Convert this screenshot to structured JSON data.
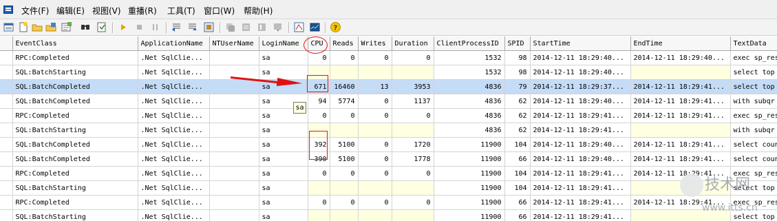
{
  "menu": {
    "items": [
      "文件(F)",
      "编辑(E)",
      "视图(V)",
      "重播(R)",
      "工具(T)",
      "窗口(W)",
      "帮助(H)"
    ]
  },
  "toolbar": {
    "icons": [
      "new-trace-icon",
      "new-template-icon",
      "open-icon",
      "save-icon",
      "properties-icon",
      "find-icon",
      "clear-window-icon",
      "run-icon",
      "stop-icon",
      "pause-icon",
      "step-icon",
      "run-to-cursor-icon",
      "replay-icon",
      "toggle-bookmark-icon",
      "next-bookmark-icon",
      "prev-bookmark-icon",
      "clear-bookmarks-icon",
      "go-to-line-icon",
      "performance-monitor-icon",
      "performance-chart-icon",
      "help-icon"
    ]
  },
  "grid": {
    "columns": [
      "EventClass",
      "ApplicationName",
      "NTUserName",
      "LoginName",
      "CPU",
      "Reads",
      "Writes",
      "Duration",
      "ClientProcessID",
      "SPID",
      "StartTime",
      "EndTime",
      "TextData"
    ],
    "rows": [
      {
        "EventClass": "RPC:Completed",
        "ApplicationName": ".Net SqlClie...",
        "NTUserName": "",
        "LoginName": "sa",
        "CPU": "0",
        "Reads": "0",
        "Writes": "0",
        "Duration": "0",
        "ClientProcessID": "1532",
        "SPID": "98",
        "StartTime": "2014-12-11 18:29:40...",
        "EndTime": "2014-12-11 18:29:40...",
        "TextData": "exec sp_reset"
      },
      {
        "EventClass": "SQL:BatchStarting",
        "ApplicationName": ".Net SqlClie...",
        "NTUserName": "",
        "LoginName": "sa",
        "CPU": "",
        "Reads": "",
        "Writes": "",
        "Duration": "",
        "ClientProcessID": "1532",
        "SPID": "98",
        "StartTime": "2014-12-11 18:29:40...",
        "EndTime": "",
        "TextData": "select top"
      },
      {
        "EventClass": "SQL:BatchCompleted",
        "ApplicationName": ".Net SqlClie...",
        "NTUserName": "",
        "LoginName": "sa",
        "CPU": "671",
        "Reads": "16460",
        "Writes": "13",
        "Duration": "3953",
        "ClientProcessID": "4836",
        "SPID": "79",
        "StartTime": "2014-12-11 18:29:37...",
        "EndTime": "2014-12-11 18:29:41...",
        "TextData": "select top"
      },
      {
        "EventClass": "SQL:BatchCompleted",
        "ApplicationName": ".Net SqlClie...",
        "NTUserName": "",
        "LoginName": "sa",
        "CPU": "94",
        "Reads": "5774",
        "Writes": "0",
        "Duration": "1137",
        "ClientProcessID": "4836",
        "SPID": "62",
        "StartTime": "2014-12-11 18:29:40...",
        "EndTime": "2014-12-11 18:29:41...",
        "TextData": " with subqr"
      },
      {
        "EventClass": "RPC:Completed",
        "ApplicationName": ".Net SqlClie...",
        "NTUserName": "",
        "LoginName": "sa",
        "CPU": "0",
        "Reads": "0",
        "Writes": "0",
        "Duration": "0",
        "ClientProcessID": "4836",
        "SPID": "62",
        "StartTime": "2014-12-11 18:29:41...",
        "EndTime": "2014-12-11 18:29:41...",
        "TextData": "exec sp_reset"
      },
      {
        "EventClass": "SQL:BatchStarting",
        "ApplicationName": ".Net SqlClie...",
        "NTUserName": "",
        "LoginName": "sa",
        "CPU": "",
        "Reads": "",
        "Writes": "",
        "Duration": "",
        "ClientProcessID": "4836",
        "SPID": "62",
        "StartTime": "2014-12-11 18:29:41...",
        "EndTime": "",
        "TextData": " with subqr"
      },
      {
        "EventClass": "SQL:BatchCompleted",
        "ApplicationName": ".Net SqlClie...",
        "NTUserName": "",
        "LoginName": "sa",
        "CPU": "392",
        "Reads": "5100",
        "Writes": "0",
        "Duration": "1720",
        "ClientProcessID": "11900",
        "SPID": "104",
        "StartTime": "2014-12-11 18:29:40...",
        "EndTime": "2014-12-11 18:29:41...",
        "TextData": "select count"
      },
      {
        "EventClass": "SQL:BatchCompleted",
        "ApplicationName": ".Net SqlClie...",
        "NTUserName": "",
        "LoginName": "sa",
        "CPU": "390",
        "Reads": "5100",
        "Writes": "0",
        "Duration": "1778",
        "ClientProcessID": "11900",
        "SPID": "66",
        "StartTime": "2014-12-11 18:29:40...",
        "EndTime": "2014-12-11 18:29:41...",
        "TextData": "select count"
      },
      {
        "EventClass": "RPC:Completed",
        "ApplicationName": ".Net SqlClie...",
        "NTUserName": "",
        "LoginName": "sa",
        "CPU": "0",
        "Reads": "0",
        "Writes": "0",
        "Duration": "0",
        "ClientProcessID": "11900",
        "SPID": "104",
        "StartTime": "2014-12-11 18:29:41...",
        "EndTime": "2014-12-11 18:29:41...",
        "TextData": "exec sp_reset"
      },
      {
        "EventClass": "SQL:BatchStarting",
        "ApplicationName": ".Net SqlClie...",
        "NTUserName": "",
        "LoginName": "sa",
        "CPU": "",
        "Reads": "",
        "Writes": "",
        "Duration": "",
        "ClientProcessID": "11900",
        "SPID": "104",
        "StartTime": "2014-12-11 18:29:41...",
        "EndTime": "",
        "TextData": "select top"
      },
      {
        "EventClass": "RPC:Completed",
        "ApplicationName": ".Net SqlClie...",
        "NTUserName": "",
        "LoginName": "sa",
        "CPU": "0",
        "Reads": "0",
        "Writes": "0",
        "Duration": "0",
        "ClientProcessID": "11900",
        "SPID": "66",
        "StartTime": "2014-12-11 18:29:41...",
        "EndTime": "2014-12-11 18:29:41...",
        "TextData": "exec sp_reset"
      },
      {
        "EventClass": "SQL:BatchStarting",
        "ApplicationName": ".Net SqlClie...",
        "NTUserName": "",
        "LoginName": "sa",
        "CPU": "",
        "Reads": "",
        "Writes": "",
        "Duration": "",
        "ClientProcessID": "11900",
        "SPID": "66",
        "StartTime": "2014-12-11 18:29:41...",
        "EndTime": "",
        "TextData": "select top"
      }
    ],
    "selected_row": 2,
    "tooltip": "sa"
  },
  "colors": {
    "selected_row": "#c5dcf7",
    "empty_cell": "#ffffe1",
    "annotation": "#e11111"
  },
  "watermark": {
    "brand": "技术网",
    "url": "www.itts.cn"
  }
}
